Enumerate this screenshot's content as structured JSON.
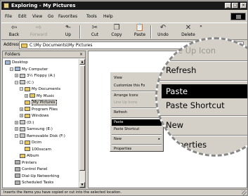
{
  "window": {
    "title": "Exploring - My Pictures",
    "minimize": "_",
    "maximize": "□",
    "close": "×"
  },
  "menu": {
    "file": "File",
    "edit": "Edit",
    "view": "View",
    "go": "Go",
    "favorites": "Favorites",
    "tools": "Tools",
    "help": "Help"
  },
  "toolbar": {
    "back": "Back",
    "forward": "Forward",
    "up": "Up",
    "cut": "Cut",
    "copy": "Copy",
    "paste": "Paste",
    "undo": "Undo",
    "delete": "Delete",
    "more": "»"
  },
  "address": {
    "label": "Address",
    "value": "C:\\My Documents\\My Pictures"
  },
  "folders": {
    "title": "Folders",
    "close": "×",
    "tree": [
      {
        "label": "Desktop",
        "indent": 0,
        "pm": "",
        "icon": "pc"
      },
      {
        "label": "My Computer",
        "indent": 1,
        "pm": "−",
        "icon": "pc"
      },
      {
        "label": "3½ Floppy (A:)",
        "indent": 2,
        "pm": "+",
        "icon": "drive"
      },
      {
        "label": "(C:)",
        "indent": 2,
        "pm": "−",
        "icon": "drive"
      },
      {
        "label": "My Documents",
        "indent": 3,
        "pm": "−",
        "icon": "folder"
      },
      {
        "label": "My Music",
        "indent": 4,
        "pm": "+",
        "icon": "folder"
      },
      {
        "label": "My Pictures",
        "indent": 4,
        "pm": "",
        "icon": "folder",
        "selected": true
      },
      {
        "label": "Program Files",
        "indent": 3,
        "pm": "+",
        "icon": "folder"
      },
      {
        "label": "Windows",
        "indent": 3,
        "pm": "+",
        "icon": "folder"
      },
      {
        "label": "(D:)",
        "indent": 2,
        "pm": "+",
        "icon": "drive"
      },
      {
        "label": "Samsung (E:)",
        "indent": 2,
        "pm": "+",
        "icon": "drive"
      },
      {
        "label": "Removable Disk (F:)",
        "indent": 2,
        "pm": "−",
        "icon": "drive"
      },
      {
        "label": "Dcim",
        "indent": 3,
        "pm": "−",
        "icon": "folder"
      },
      {
        "label": "100sscam",
        "indent": 4,
        "pm": "",
        "icon": "folder"
      },
      {
        "label": "Album",
        "indent": 3,
        "pm": "",
        "icon": "folder"
      },
      {
        "label": "Printers",
        "indent": 2,
        "pm": "",
        "icon": "sys"
      },
      {
        "label": "Control Panel",
        "indent": 2,
        "pm": "",
        "icon": "sys"
      },
      {
        "label": "Dial-Up Networking",
        "indent": 2,
        "pm": "",
        "icon": "sys"
      },
      {
        "label": "Scheduled Tasks",
        "indent": 2,
        "pm": "",
        "icon": "sys"
      }
    ]
  },
  "context_menu": {
    "items": [
      {
        "label": "View",
        "disabled": false,
        "arrow": "▸"
      },
      {
        "label": "Customize this Fo",
        "disabled": false
      },
      {
        "label": "Arrange Icons",
        "disabled": false,
        "arrow": "▸"
      },
      {
        "label": "Line Up Icons",
        "disabled": true
      },
      {
        "label": "Refresh",
        "disabled": false
      },
      {
        "label": "Paste",
        "disabled": false,
        "highlighted": true
      },
      {
        "label": "Paste Shortcut",
        "disabled": false
      },
      {
        "label": "New",
        "disabled": false,
        "arrow": "▸"
      },
      {
        "label": "Properties",
        "disabled": false
      }
    ]
  },
  "zoom": {
    "line_up_icons": "Line Up Icon",
    "refresh": "Refresh",
    "paste": "Paste",
    "paste_shortcut": "Paste Shortcut",
    "new": "New",
    "properties": "Properties"
  },
  "status": {
    "text": "Inserts the items you have copied or cut into the selected location."
  }
}
